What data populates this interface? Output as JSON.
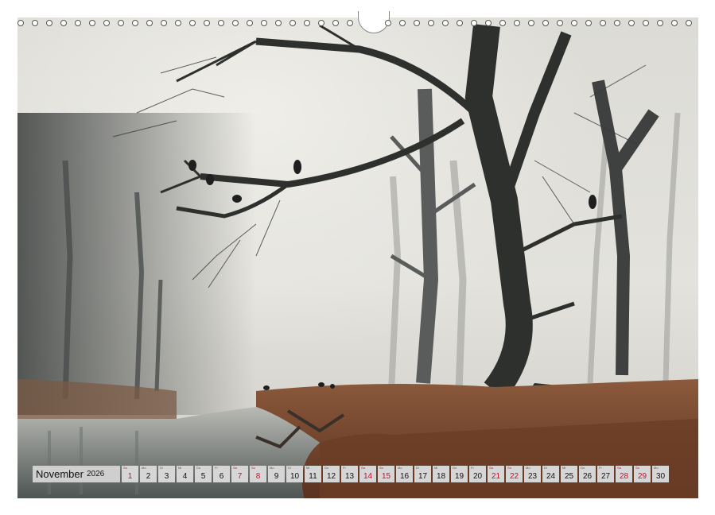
{
  "calendar": {
    "month": "November",
    "year": "2026",
    "days": [
      {
        "dow": "So",
        "num": "1",
        "red": true
      },
      {
        "dow": "Mo",
        "num": "2",
        "red": false
      },
      {
        "dow": "Di",
        "num": "3",
        "red": false
      },
      {
        "dow": "Mi",
        "num": "4",
        "red": false
      },
      {
        "dow": "Do",
        "num": "5",
        "red": false
      },
      {
        "dow": "Fr",
        "num": "6",
        "red": false
      },
      {
        "dow": "Sa",
        "num": "7",
        "red": true
      },
      {
        "dow": "So",
        "num": "8",
        "red": true
      },
      {
        "dow": "Mo",
        "num": "9",
        "red": false
      },
      {
        "dow": "Di",
        "num": "10",
        "red": false
      },
      {
        "dow": "Mi",
        "num": "11",
        "red": false
      },
      {
        "dow": "Do",
        "num": "12",
        "red": false
      },
      {
        "dow": "Fr",
        "num": "13",
        "red": false
      },
      {
        "dow": "Sa",
        "num": "14",
        "red": true
      },
      {
        "dow": "So",
        "num": "15",
        "red": true
      },
      {
        "dow": "Mo",
        "num": "16",
        "red": false
      },
      {
        "dow": "Di",
        "num": "17",
        "red": false
      },
      {
        "dow": "Mi",
        "num": "18",
        "red": false
      },
      {
        "dow": "Do",
        "num": "19",
        "red": false
      },
      {
        "dow": "Fr",
        "num": "20",
        "red": false
      },
      {
        "dow": "Sa",
        "num": "21",
        "red": true
      },
      {
        "dow": "So",
        "num": "22",
        "red": true
      },
      {
        "dow": "Mo",
        "num": "23",
        "red": false
      },
      {
        "dow": "Di",
        "num": "24",
        "red": false
      },
      {
        "dow": "Mi",
        "num": "25",
        "red": false
      },
      {
        "dow": "Do",
        "num": "26",
        "red": false
      },
      {
        "dow": "Fr",
        "num": "27",
        "red": false
      },
      {
        "dow": "Sa",
        "num": "28",
        "red": true
      },
      {
        "dow": "So",
        "num": "29",
        "red": true
      },
      {
        "dow": "Mo",
        "num": "30",
        "red": false
      }
    ]
  },
  "colors": {
    "weekend_red": "#c8102e",
    "fog": "#e4e2dc",
    "tree": "#2e302e",
    "leaves": "#8a4a2a"
  },
  "photo": {
    "icons": [
      "forest-photo",
      "raven-icon"
    ]
  }
}
